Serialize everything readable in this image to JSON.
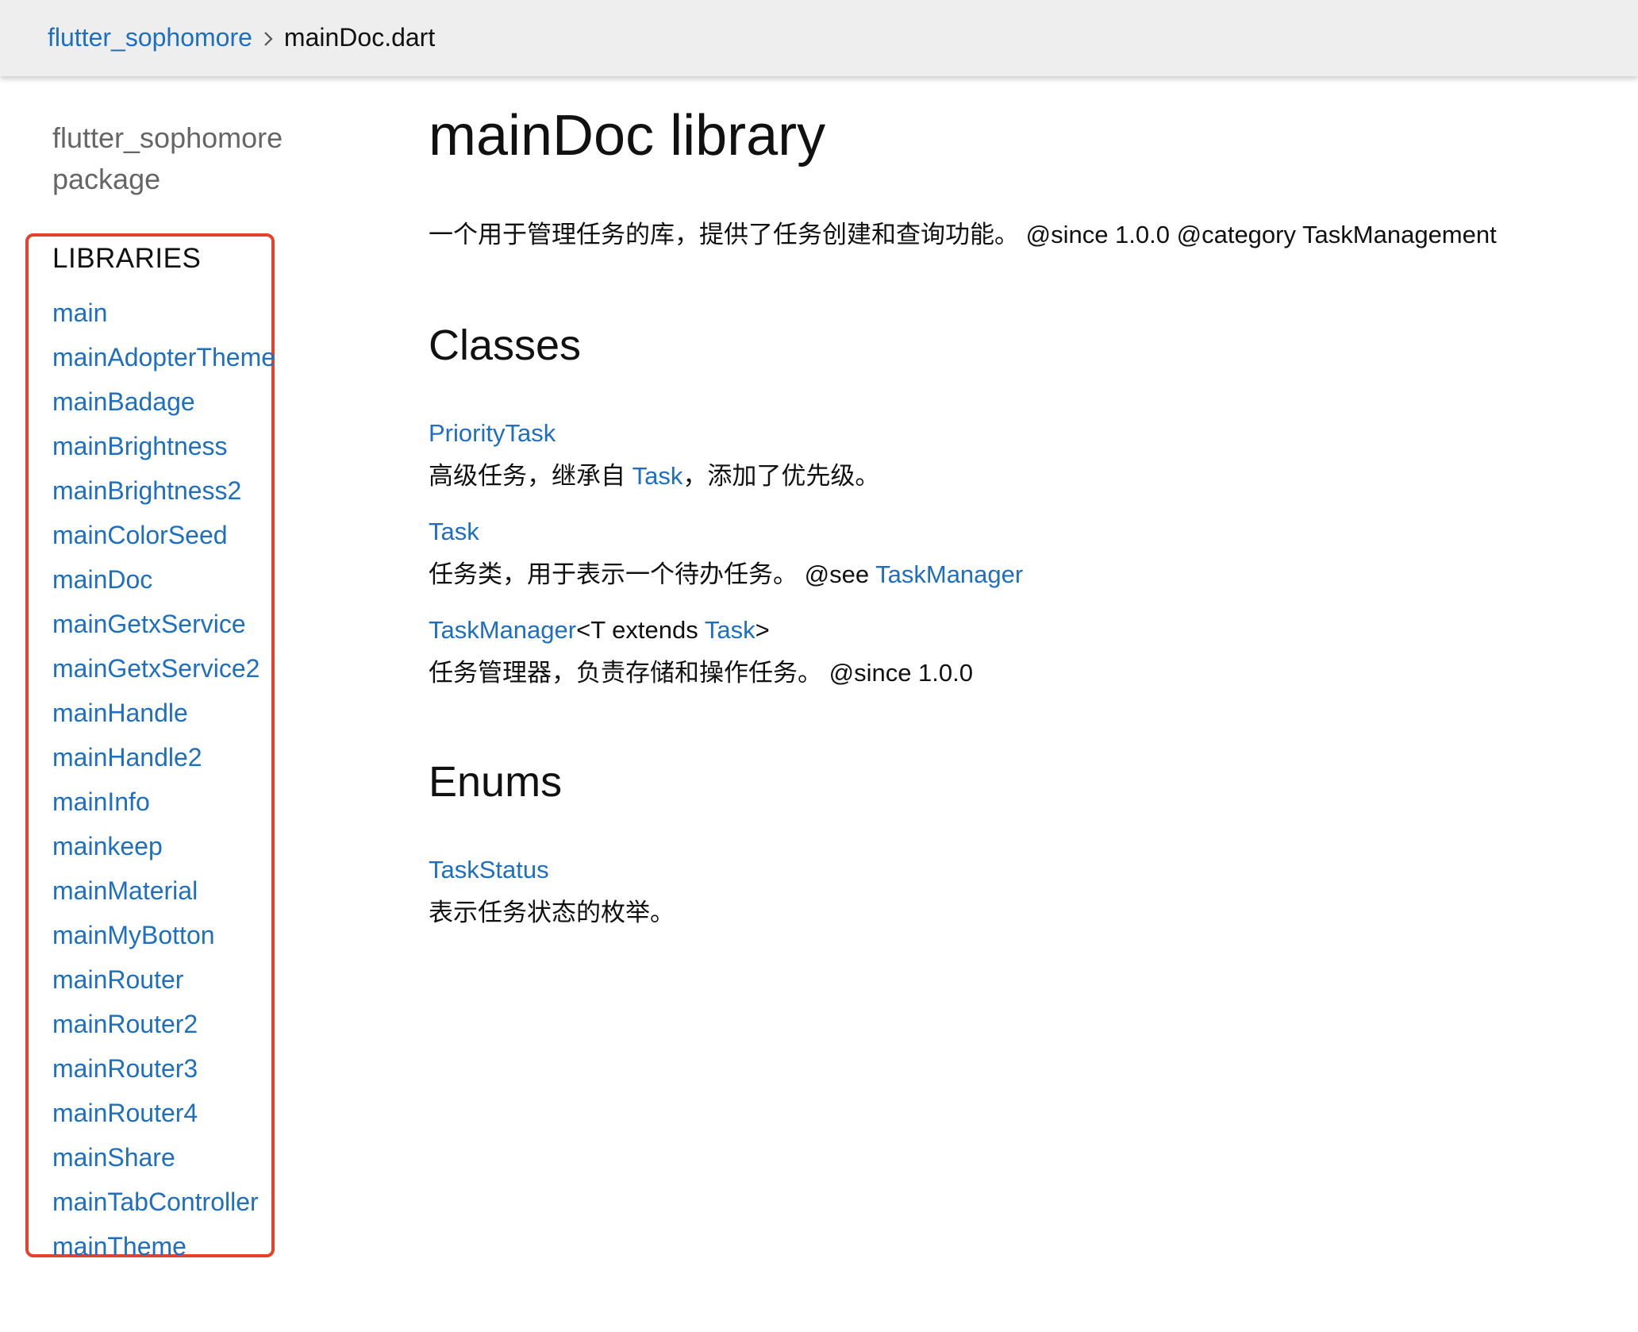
{
  "breadcrumb": {
    "package_link": "flutter_sophomore",
    "separator_icon": "chevron-right-icon",
    "current": "mainDoc.dart"
  },
  "sidebar": {
    "package_line1": "flutter_sophomore",
    "package_line2": "package",
    "libraries_heading": "LIBRARIES",
    "highlight_color": "#e5412d",
    "libraries": [
      "main",
      "mainAdopterTheme",
      "mainBadage",
      "mainBrightness",
      "mainBrightness2",
      "mainColorSeed",
      "mainDoc",
      "mainGetxService",
      "mainGetxService2",
      "mainHandle",
      "mainHandle2",
      "mainInfo",
      "mainkeep",
      "mainMaterial",
      "mainMyBotton",
      "mainRouter",
      "mainRouter2",
      "mainRouter3",
      "mainRouter4",
      "mainShare",
      "mainTabController",
      "mainTheme"
    ]
  },
  "main": {
    "title": "mainDoc library",
    "description": "一个用于管理任务的库，提供了任务创建和查询功能。 @since 1.0.0 @category TaskManagement",
    "classes_heading": "Classes",
    "classes": [
      {
        "name": "PriorityTask",
        "desc_prefix": "高级任务，继承自 ",
        "desc_link": "Task",
        "desc_suffix": "，添加了优先级。"
      },
      {
        "name": "Task",
        "desc_prefix": "任务类，用于表示一个待办任务。 @see ",
        "desc_link": "TaskManager",
        "desc_suffix": ""
      },
      {
        "name": "TaskManager",
        "generic_open": "<T extends ",
        "generic_link": "Task",
        "generic_close": ">",
        "desc": "任务管理器，负责存储和操作任务。 @since 1.0.0"
      }
    ],
    "enums_heading": "Enums",
    "enums": [
      {
        "name": "TaskStatus",
        "desc": "表示任务状态的枚举。"
      }
    ]
  },
  "colors": {
    "link": "#1e6fbf",
    "header_bg": "#eeeeee",
    "muted_text": "#666666"
  }
}
